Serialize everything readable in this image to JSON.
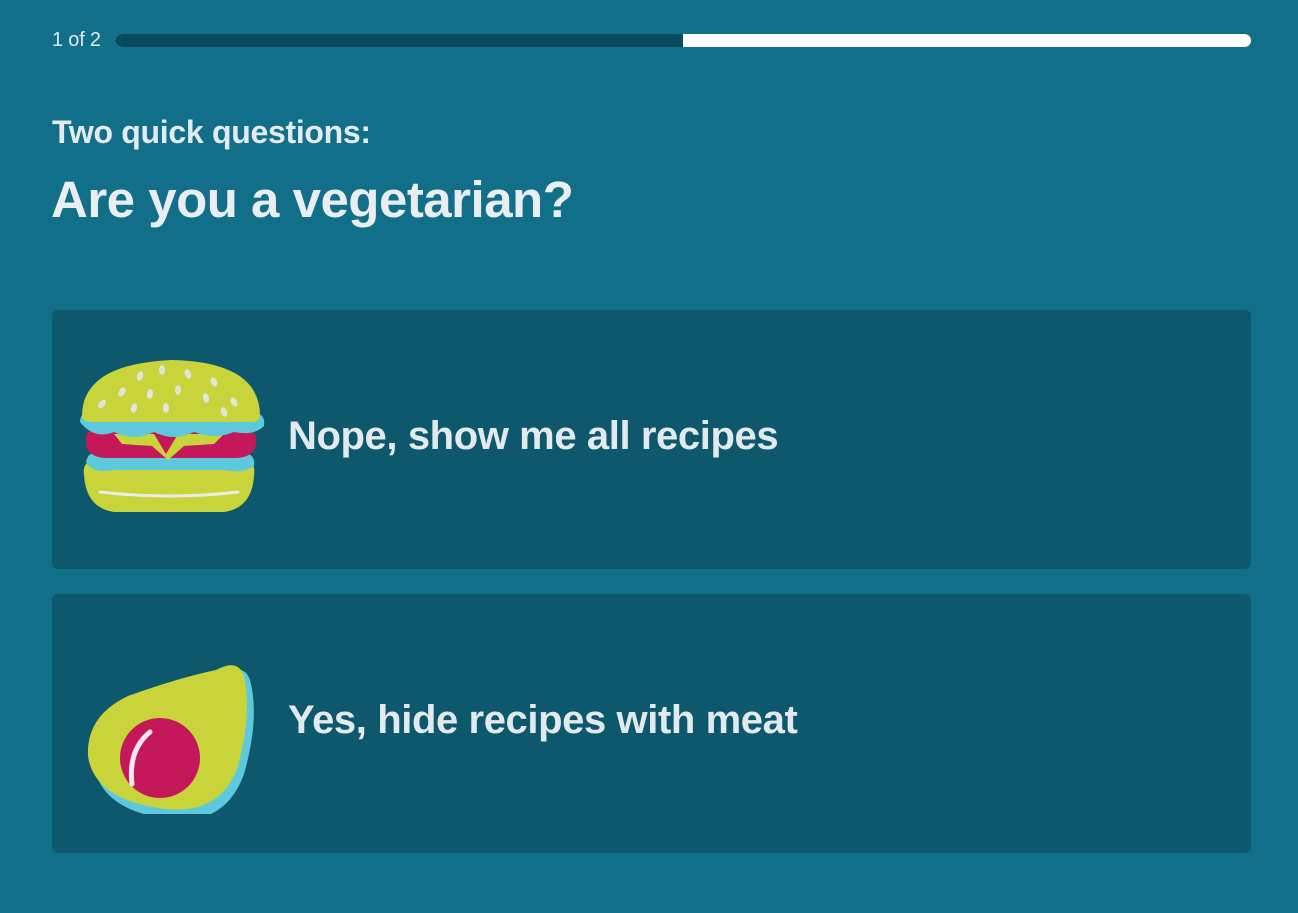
{
  "progress": {
    "step_label": "1 of 2",
    "fraction_complete": 0.5,
    "fill_color": "#0b4a5d",
    "track_color": "#ffffff"
  },
  "header": {
    "subtitle": "Two quick questions:",
    "question": "Are you a vegetarian?"
  },
  "options": [
    {
      "label": "Nope, show me all recipes",
      "icon": "burger-icon"
    },
    {
      "label": "Yes, hide recipes with meat",
      "icon": "avocado-icon"
    }
  ],
  "colors": {
    "background": "#126f8a",
    "card": "#0d586d",
    "accent_yellow": "#c9d43a",
    "accent_cyan": "#5ec8dc",
    "accent_magenta": "#c4185a"
  }
}
